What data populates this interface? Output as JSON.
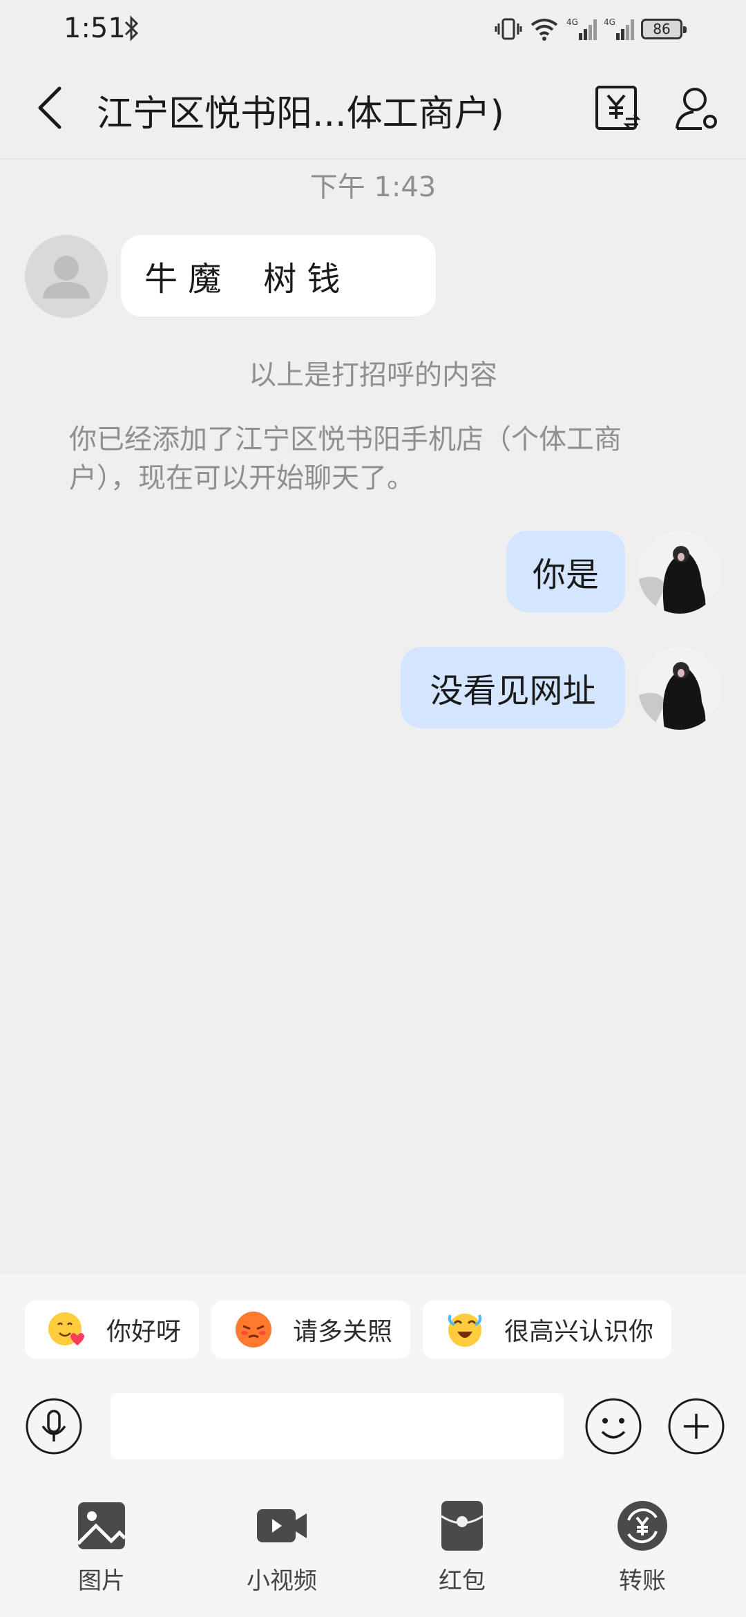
{
  "status_bar": {
    "time": "1:51",
    "battery": "86",
    "network_1": "4G",
    "network_2": "4G"
  },
  "header": {
    "title": "江宁区悦书阳...体工商户)"
  },
  "messages": {
    "timestamp": "下午 1:43",
    "incoming_text": "牛 魔    树 钱",
    "greeting_note": "以上是打招呼的内容",
    "added_note": "你已经添加了江宁区悦书阳手机店（个体工商户），现在可以开始聊天了。",
    "outgoing": [
      {
        "text": "你是"
      },
      {
        "text": "没看见网址"
      }
    ]
  },
  "quick_replies": [
    {
      "label": "你好呀",
      "icon": "smile-heart-emoji-icon"
    },
    {
      "label": "请多关照",
      "icon": "shy-emoji-icon"
    },
    {
      "label": "很高兴认识你",
      "icon": "happy-tears-emoji-icon"
    }
  ],
  "input": {
    "value": "",
    "placeholder": ""
  },
  "toolbar": [
    {
      "label": "图片",
      "icon": "image-icon"
    },
    {
      "label": "小视频",
      "icon": "video-icon"
    },
    {
      "label": "红包",
      "icon": "red-packet-icon"
    },
    {
      "label": "转账",
      "icon": "transfer-icon"
    }
  ],
  "colors": {
    "background": "#efefef",
    "outgoing_bubble": "#d4e6ff",
    "incoming_bubble": "#ffffff",
    "meta_text": "#8f8f8f"
  }
}
